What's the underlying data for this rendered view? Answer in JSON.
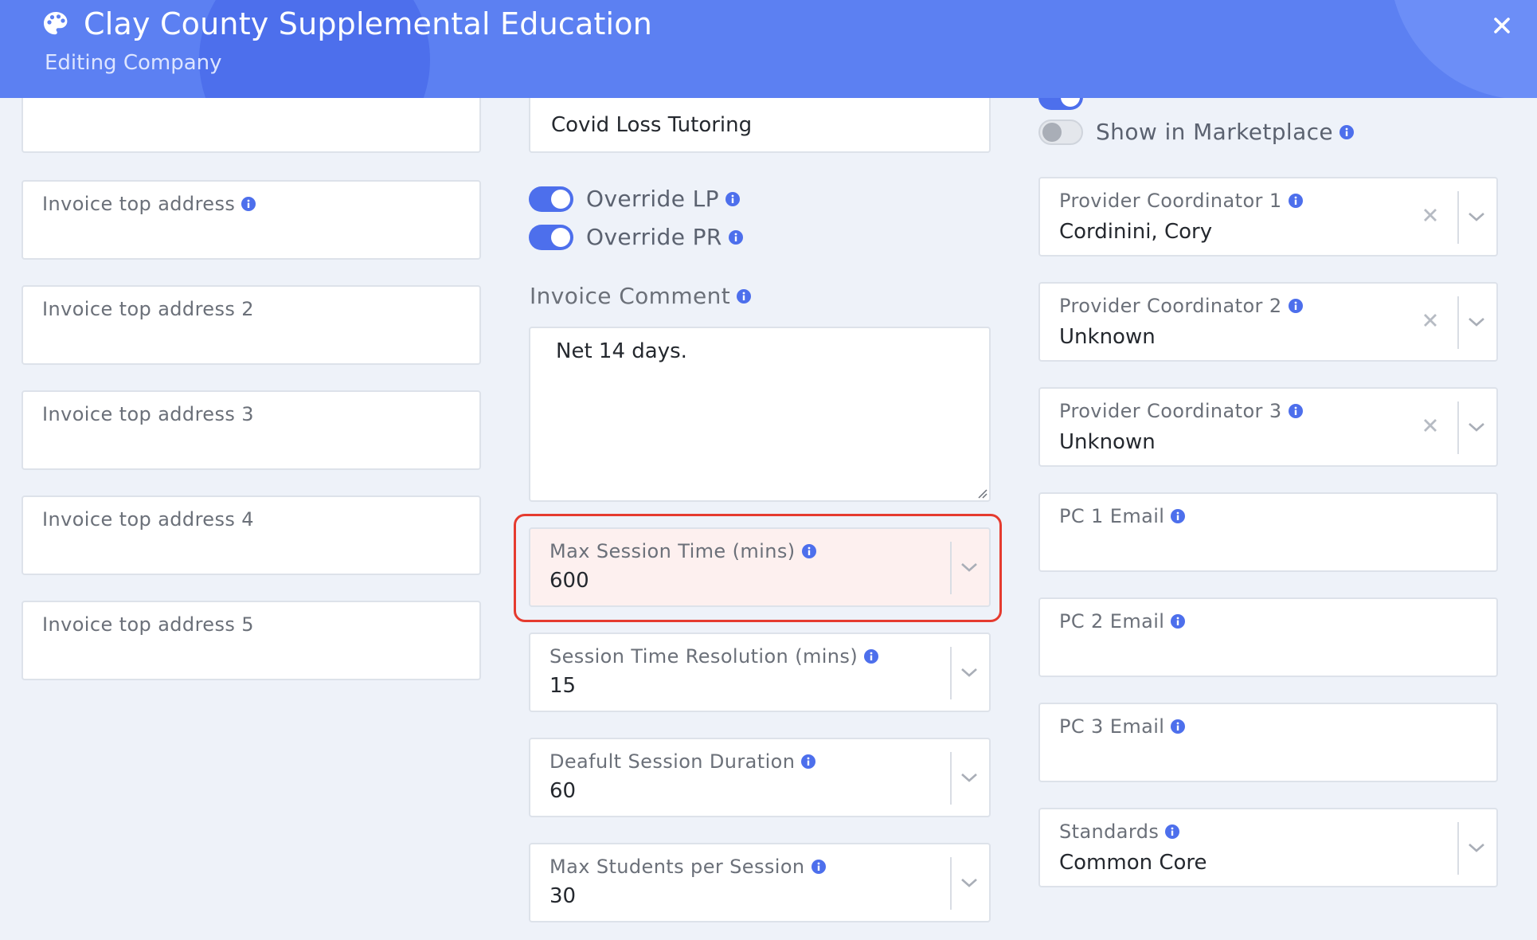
{
  "header": {
    "title": "Clay County Supplemental Education",
    "subtitle": "Editing Company",
    "app_icon": "palette-icon",
    "close_icon": "close-icon"
  },
  "left_column": {
    "invoice_top_address_1": {
      "label": "Invoice top address",
      "value": ""
    },
    "invoice_top_address_2": {
      "label": "Invoice top address 2",
      "value": ""
    },
    "invoice_top_address_3": {
      "label": "Invoice top address 3",
      "value": ""
    },
    "invoice_top_address_4": {
      "label": "Invoice top address 4",
      "value": ""
    },
    "invoice_top_address_5": {
      "label": "Invoice top address 5",
      "value": ""
    }
  },
  "middle_column": {
    "top_field_value": "Covid Loss Tutoring",
    "override_lp": {
      "label": "Override LP",
      "on": true
    },
    "override_pr": {
      "label": "Override PR",
      "on": true
    },
    "invoice_comment": {
      "label": "Invoice Comment",
      "value": "Net 14 days."
    },
    "max_session_time": {
      "label": "Max Session Time (mins)",
      "value": "600",
      "highlighted": true
    },
    "session_time_resolution": {
      "label": "Session Time Resolution (mins)",
      "value": "15"
    },
    "default_session_duration": {
      "label": "Deafult Session Duration",
      "value": "60"
    },
    "max_students_per_session": {
      "label": "Max Students per Session",
      "value": "30"
    }
  },
  "right_column": {
    "signatures_toggle": {
      "on": true
    },
    "show_in_marketplace": {
      "label": "Show in Marketplace",
      "on": false
    },
    "provider_coordinator_1": {
      "label": "Provider Coordinator 1",
      "value": "Cordinini, Cory"
    },
    "provider_coordinator_2": {
      "label": "Provider Coordinator 2",
      "value": "Unknown"
    },
    "provider_coordinator_3": {
      "label": "Provider Coordinator 3",
      "value": "Unknown"
    },
    "pc1_email": {
      "label": "PC 1 Email",
      "value": ""
    },
    "pc2_email": {
      "label": "PC 2 Email",
      "value": ""
    },
    "pc3_email": {
      "label": "PC 3 Email",
      "value": ""
    },
    "standards": {
      "label": "Standards",
      "value": "Common Core"
    }
  },
  "colors": {
    "header_bg": "#5c80f2",
    "accent": "#4d6fec",
    "highlight_border": "#e53b2f",
    "page_bg": "#eef2f9"
  }
}
